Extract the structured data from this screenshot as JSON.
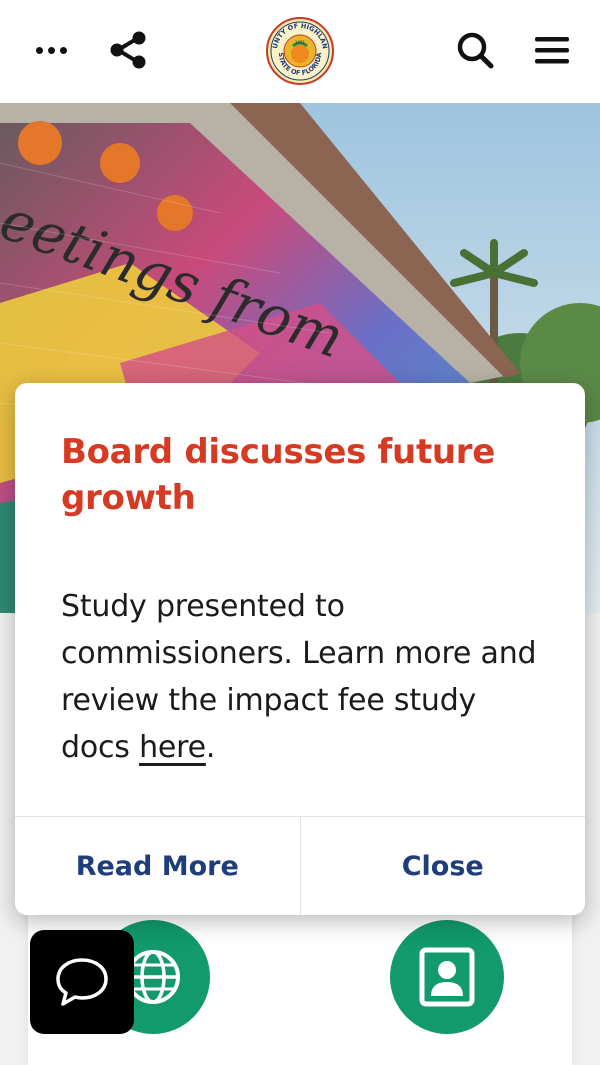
{
  "header": {
    "icons": [
      "more-icon",
      "share-icon",
      "county-seal-logo",
      "search-icon",
      "menu-icon"
    ],
    "seal_text_top": "COUNTY OF HIGHLANDS",
    "seal_text_bottom": "STATE OF FLORIDA",
    "seal_year": "1921"
  },
  "hero": {
    "mural_text": "eetings from"
  },
  "modal": {
    "title": "Board discusses future growth",
    "body_text": "Study presented to commissioners. Learn more and review the impact fee study docs ",
    "body_link": "here",
    "body_end": ".",
    "read_more_label": "Read More",
    "close_label": "Close"
  },
  "quick_links": {
    "icons": [
      "globe-icon",
      "contact-card-icon"
    ]
  },
  "chat": {
    "icon": "chat-bubble-icon"
  },
  "colors": {
    "title_red": "#d63a23",
    "action_blue": "#1f3d7a",
    "green": "#129a6c",
    "chat_bg": "#000000"
  }
}
